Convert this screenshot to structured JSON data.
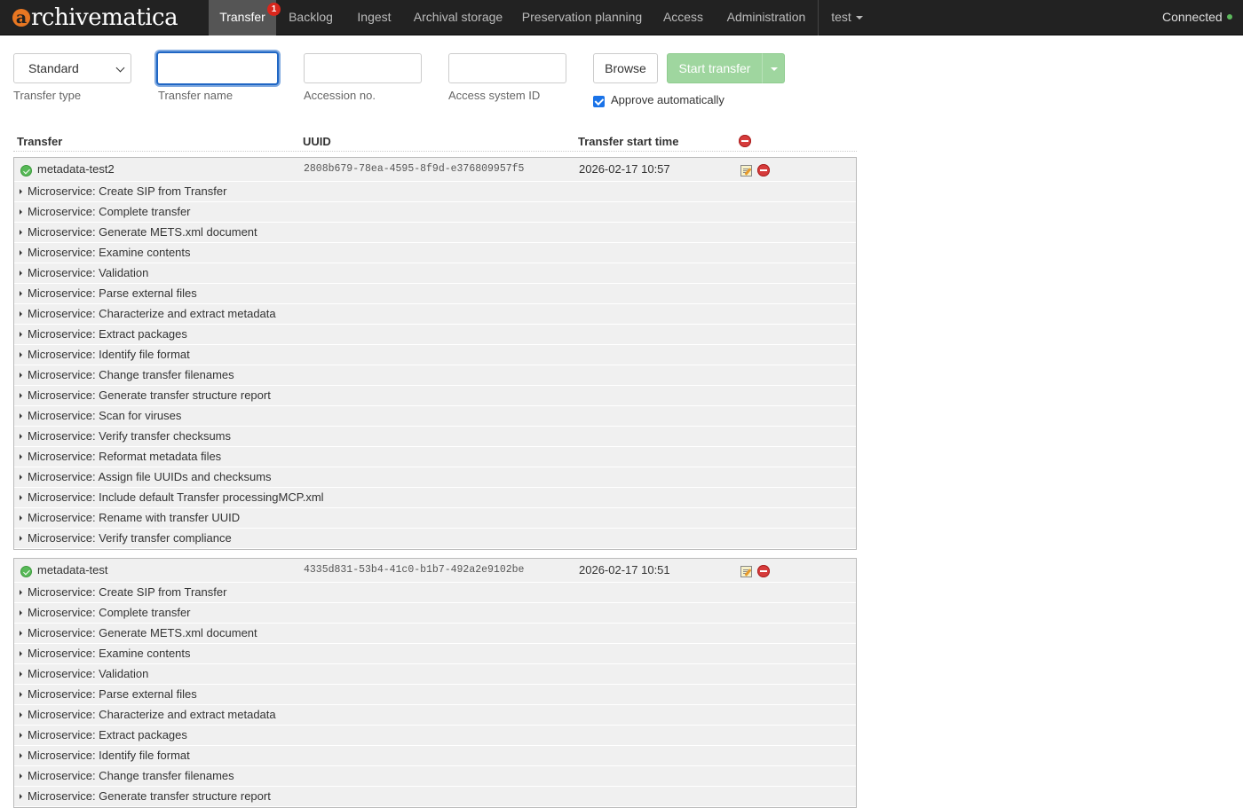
{
  "navbar": {
    "brand_letter": "a",
    "brand_rest": "rchivematica",
    "items": [
      {
        "label": "Transfer",
        "active": true,
        "badge": "1"
      },
      {
        "label": "Backlog"
      },
      {
        "label": "Ingest"
      },
      {
        "label": "Archival storage"
      },
      {
        "label": "Preservation planning"
      },
      {
        "label": "Access"
      },
      {
        "label": "Administration"
      }
    ],
    "user": "test",
    "status": "Connected",
    "status_color": "#5cb85c"
  },
  "form": {
    "transfer_type": {
      "value": "Standard",
      "label": "Transfer type"
    },
    "transfer_name": {
      "value": "",
      "label": "Transfer name"
    },
    "accession_no": {
      "value": "",
      "label": "Accession no."
    },
    "access_system_id": {
      "value": "",
      "label": "Access system ID"
    },
    "browse_label": "Browse",
    "start_label": "Start transfer",
    "approve_automatically": {
      "label": "Approve automatically",
      "checked": true
    }
  },
  "table": {
    "headers": {
      "transfer": "Transfer",
      "uuid": "UUID",
      "start_time": "Transfer start time"
    },
    "transfers": [
      {
        "name": "metadata-test2",
        "uuid": "2808b679-78ea-4595-8f9d-e376809957f5",
        "start_time": "2026-02-17 10:57",
        "status": "complete",
        "microservices": [
          "Microservice: Create SIP from Transfer",
          "Microservice: Complete transfer",
          "Microservice: Generate METS.xml document",
          "Microservice: Examine contents",
          "Microservice: Validation",
          "Microservice: Parse external files",
          "Microservice: Characterize and extract metadata",
          "Microservice: Extract packages",
          "Microservice: Identify file format",
          "Microservice: Change transfer filenames",
          "Microservice: Generate transfer structure report",
          "Microservice: Scan for viruses",
          "Microservice: Verify transfer checksums",
          "Microservice: Reformat metadata files",
          "Microservice: Assign file UUIDs and checksums",
          "Microservice: Include default Transfer processingMCP.xml",
          "Microservice: Rename with transfer UUID",
          "Microservice: Verify transfer compliance"
        ]
      },
      {
        "name": "metadata-test",
        "uuid": "4335d831-53b4-41c0-b1b7-492a2e9102be",
        "start_time": "2026-02-17 10:51",
        "status": "complete",
        "microservices": [
          "Microservice: Create SIP from Transfer",
          "Microservice: Complete transfer",
          "Microservice: Generate METS.xml document",
          "Microservice: Examine contents",
          "Microservice: Validation",
          "Microservice: Parse external files",
          "Microservice: Characterize and extract metadata",
          "Microservice: Extract packages",
          "Microservice: Identify file format",
          "Microservice: Change transfer filenames",
          "Microservice: Generate transfer structure report"
        ]
      }
    ]
  }
}
